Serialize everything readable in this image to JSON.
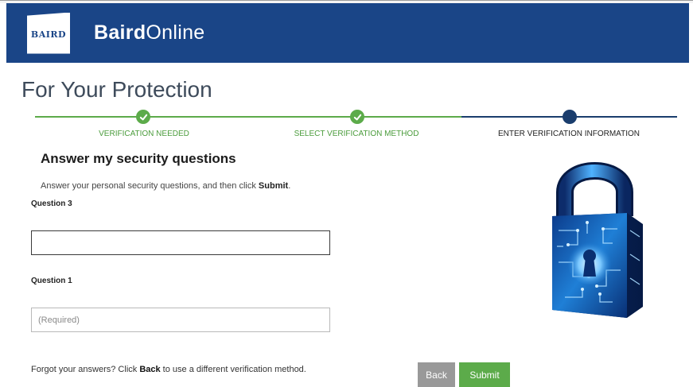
{
  "header": {
    "logo_text": "BAIRD",
    "app_name_bold": "Baird",
    "app_name_rest": "Online"
  },
  "page": {
    "title": "For Your Protection"
  },
  "steps": [
    {
      "label": "VERIFICATION NEEDED",
      "state": "done"
    },
    {
      "label": "SELECT VERIFICATION METHOD",
      "state": "done"
    },
    {
      "label": "ENTER VERIFICATION INFORMATION",
      "state": "current"
    }
  ],
  "form": {
    "title": "Answer my security questions",
    "instructions_prefix": "Answer your personal security questions, and then click ",
    "instructions_bold": "Submit",
    "instructions_suffix": ".",
    "questions": [
      {
        "label": "Question 3",
        "value": "",
        "placeholder": ""
      },
      {
        "label": "Question 1",
        "value": "",
        "placeholder": "(Required)"
      }
    ],
    "footer_prefix": "Forgot your answers? Click ",
    "footer_bold": "Back",
    "footer_suffix": " to use a different verification method.",
    "back_label": "Back",
    "submit_label": "Submit"
  },
  "colors": {
    "brand_blue": "#1a4587",
    "complete_green": "#5cab4a",
    "pending_navy": "#1a3d6d",
    "back_gray": "#999999"
  },
  "icons": {
    "step_done": "check-icon",
    "illustration": "padlock-illustration"
  }
}
